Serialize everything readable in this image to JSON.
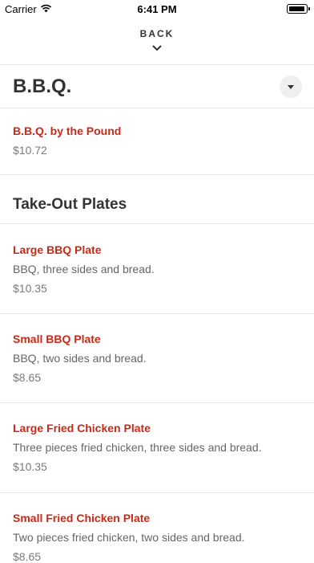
{
  "status_bar": {
    "carrier": "Carrier",
    "time": "6:41 PM"
  },
  "nav": {
    "back_label": "BACK"
  },
  "category": {
    "title": "B.B.Q."
  },
  "items_top": [
    {
      "name": "B.B.Q. by the Pound",
      "price": "$10.72"
    }
  ],
  "subsection": {
    "title": "Take-Out Plates"
  },
  "plates": [
    {
      "name": "Large BBQ Plate",
      "description": "BBQ, three sides and bread.",
      "price": "$10.35"
    },
    {
      "name": "Small BBQ Plate",
      "description": "BBQ, two sides and bread.",
      "price": "$8.65"
    },
    {
      "name": "Large Fried Chicken Plate",
      "description": "Three pieces fried chicken, three sides and bread.",
      "price": "$10.35"
    },
    {
      "name": "Small Fried Chicken Plate",
      "description": "Two pieces fried chicken, two sides and bread.",
      "price": "$8.65"
    }
  ],
  "colors": {
    "accent": "#c82a17",
    "text": "#333333",
    "muted": "#7a7a7a",
    "divider": "#e6e6e6"
  },
  "icons": {
    "back": "chevron-down-icon",
    "toggle": "caret-down-icon",
    "wifi": "wifi-icon",
    "battery": "battery-icon"
  }
}
